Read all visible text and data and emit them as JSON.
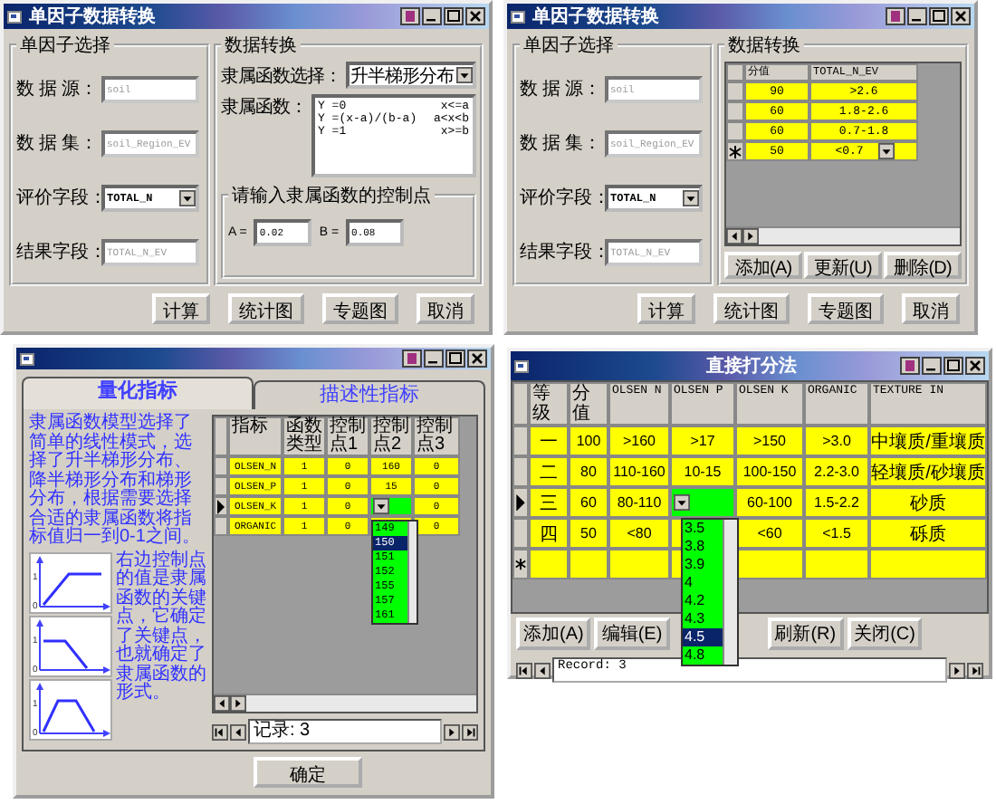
{
  "conversion_window": {
    "title": "单因子数据转换",
    "selection_group": {
      "title": "单因子选择",
      "fields": [
        {
          "label": "数 据 源：",
          "value": "soil",
          "kind": "text",
          "disabled": true
        },
        {
          "label": "数 据 集：",
          "value": "soil_Region_EV",
          "kind": "text",
          "disabled": true
        },
        {
          "label": "评价字段：",
          "value": "TOTAL_N",
          "kind": "select"
        },
        {
          "label": "结果字段：",
          "value": "TOTAL_N_EV",
          "kind": "text",
          "disabled": true
        }
      ]
    },
    "conversion_group": {
      "title": "数据转换",
      "function_label": "隶属函数选择：",
      "function_value": "升半梯形分布",
      "formula_label": "隶属函数：",
      "formula_lines": [
        {
          "expr": "Y =0",
          "condition": "x<=a"
        },
        {
          "expr": "Y =(x-a)/(b-a)",
          "condition": "a<x<b"
        },
        {
          "expr": "Y =1",
          "condition": "x>=b"
        }
      ],
      "control_group": {
        "title": "请输入隶属函数的控制点",
        "points": [
          {
            "label": "A =",
            "value": "0.02"
          },
          {
            "label": "B =",
            "value": "0.08"
          }
        ]
      }
    },
    "buttons": [
      "计算",
      "统计图",
      "专题图",
      "取消"
    ]
  },
  "table_window": {
    "title": "单因子数据转换",
    "selection_group": {
      "title": "单因子选择",
      "fields": [
        {
          "label": "数 据 源：",
          "value": "soil",
          "kind": "text",
          "disabled": true
        },
        {
          "label": "数 据 集：",
          "value": "soil_Region_EV",
          "kind": "text",
          "disabled": true
        },
        {
          "label": "评价字段：",
          "value": "TOTAL_N",
          "kind": "select"
        },
        {
          "label": "结果字段：",
          "value": "TOTAL_N_EV",
          "kind": "text",
          "disabled": true
        }
      ]
    },
    "conversion_group": {
      "title": "数据转换",
      "columns": [
        "分值",
        "TOTAL_N_EV"
      ],
      "rows": [
        {
          "selected": false,
          "new": false,
          "cells": [
            "90",
            ">2.6"
          ]
        },
        {
          "selected": false,
          "new": false,
          "cells": [
            "60",
            "1.8-2.6"
          ]
        },
        {
          "selected": false,
          "new": false,
          "cells": [
            "60",
            "0.7-1.8"
          ]
        },
        {
          "selected": false,
          "new": true,
          "cells": [
            "50",
            {
              "kind": "combo",
              "text": "<0.7"
            }
          ]
        }
      ],
      "buttons": [
        "添加(A)",
        "更新(U)",
        "删除(D)"
      ]
    },
    "buttons": [
      "计算",
      "统计图",
      "专题图",
      "取消"
    ]
  },
  "indicator_window": {
    "tabs": [
      {
        "label": "量化指标",
        "selected": true
      },
      {
        "label": "描述性指标",
        "selected": false
      }
    ],
    "description": "隶属函数模型选择了简单的线性模式，选择了升半梯形分布、降半梯形分布和梯形分布，根据需要选择合适的隶属函数将指标值归一到0-1之间。",
    "diagrams": [
      {
        "kind": "rising",
        "labels": [
          "1",
          "0"
        ]
      },
      {
        "kind": "falling",
        "labels": [
          "1",
          "0"
        ]
      },
      {
        "kind": "trapezoid",
        "labels": [
          "1",
          "0"
        ]
      }
    ],
    "note": "右边控制点的值是隶属函数的关键点，它确定了关键点，也就确定了隶属函数的形式。",
    "grid": {
      "columns": [
        "指标",
        "函数类型",
        "控制点1",
        "控制点2",
        "控制点3"
      ],
      "rows": [
        {
          "selected": false,
          "new": false,
          "cells": [
            "OLSEN_N",
            "1",
            "0",
            "160",
            "0"
          ]
        },
        {
          "selected": false,
          "new": false,
          "cells": [
            "OLSEN_P",
            "1",
            "0",
            "15",
            "0"
          ]
        },
        {
          "selected": true,
          "new": false,
          "cells": [
            "OLSEN_K",
            "1",
            "0",
            {
              "kind": "combo"
            },
            "0"
          ]
        },
        {
          "selected": false,
          "new": false,
          "cells": [
            "ORGANIC",
            "1",
            "0",
            {
              "kind": "covered"
            },
            "0"
          ]
        }
      ],
      "dropdown": [
        {
          "label": "149",
          "selected": false
        },
        {
          "label": "150",
          "selected": true
        },
        {
          "label": "151",
          "selected": false
        },
        {
          "label": "152",
          "selected": false
        },
        {
          "label": "155",
          "selected": false
        },
        {
          "label": "157",
          "selected": false
        },
        {
          "label": "161",
          "selected": false
        }
      ]
    },
    "record": "记录: 3",
    "button": "确定"
  },
  "scoring_window": {
    "title": "直接打分法",
    "columns": [
      "等级",
      "分值",
      "OLSEN N",
      "OLSEN P",
      "OLSEN K",
      "ORGANIC",
      "TEXTURE IN"
    ],
    "rows": [
      {
        "selected": false,
        "new": false,
        "cells": [
          "一",
          "100",
          ">160",
          ">17",
          ">150",
          ">3.0",
          "中壤质/重壤质"
        ]
      },
      {
        "selected": false,
        "new": false,
        "cells": [
          "二",
          "80",
          "110-160",
          "10-15",
          "100-150",
          "2.2-3.0",
          "轻壤质/砂壤质"
        ]
      },
      {
        "selected": true,
        "new": false,
        "cells": [
          "三",
          "60",
          "80-110",
          {
            "kind": "combo"
          },
          "60-100",
          "1.5-2.2",
          "砂质"
        ]
      },
      {
        "selected": false,
        "new": false,
        "cells": [
          "四",
          "50",
          "<80",
          {
            "kind": "covered"
          },
          "<60",
          "<1.5",
          "砾质"
        ]
      },
      {
        "selected": false,
        "new": true,
        "cells": [
          {
            "kind": "covered"
          },
          {
            "kind": "covered"
          },
          {
            "kind": "covered"
          },
          {
            "kind": "covered"
          },
          {
            "kind": "covered"
          },
          {
            "kind": "covered"
          },
          {
            "kind": "covered"
          }
        ]
      }
    ],
    "dropdown": [
      {
        "label": "3.5",
        "selected": false
      },
      {
        "label": "3.8",
        "selected": false
      },
      {
        "label": "3.9",
        "selected": false
      },
      {
        "label": "4",
        "selected": false
      },
      {
        "label": "4.2",
        "selected": false
      },
      {
        "label": "4.3",
        "selected": false
      },
      {
        "label": "4.5",
        "selected": true
      },
      {
        "label": "4.8",
        "selected": false
      }
    ],
    "buttons_left": [
      "添加(A)",
      "编辑(E)"
    ],
    "buttons_right": [
      "刷新(R)",
      "关闭(C)"
    ],
    "record": "Record: 3"
  }
}
